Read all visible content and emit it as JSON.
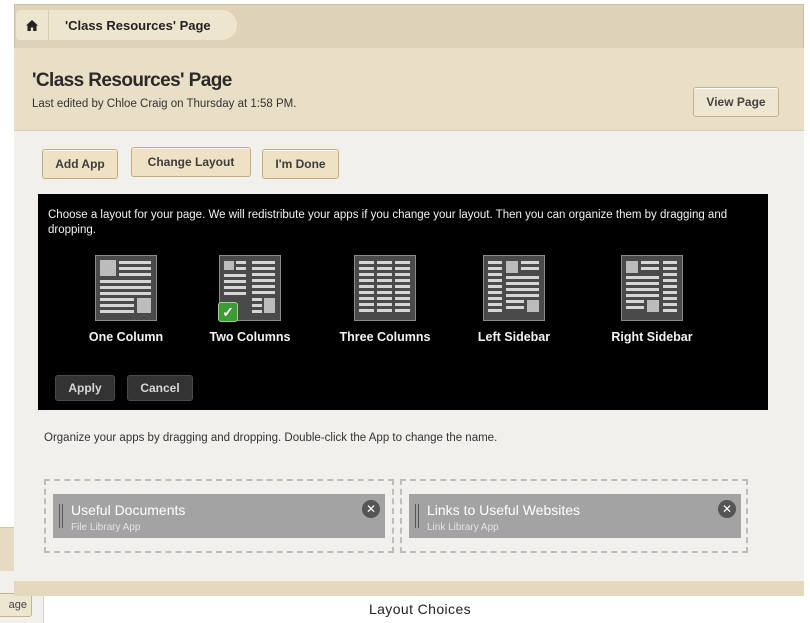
{
  "breadcrumb": {
    "home_icon": "home-icon",
    "current": "'Class Resources' Page"
  },
  "header": {
    "title": "'Class Resources' Page",
    "subtitle": "Last edited by Chloe Craig on Thursday at 1:58 PM.",
    "view_page_label": "View Page"
  },
  "toolbar": {
    "add_app_label": "Add App",
    "change_layout_label": "Change Layout",
    "done_label": "I'm Done"
  },
  "layout_panel": {
    "instructions": "Choose a layout for your page. We will redistribute your apps if you change your layout. Then you can organize them by dragging and dropping.",
    "options": [
      {
        "label": "One Column",
        "icon": "one-column-layout-icon",
        "selected": false
      },
      {
        "label": "Two Columns",
        "icon": "two-columns-layout-icon",
        "selected": true
      },
      {
        "label": "Three Columns",
        "icon": "three-columns-layout-icon",
        "selected": false
      },
      {
        "label": "Left Sidebar",
        "icon": "left-sidebar-layout-icon",
        "selected": false
      },
      {
        "label": "Right Sidebar",
        "icon": "right-sidebar-layout-icon",
        "selected": false
      }
    ],
    "apply_label": "Apply",
    "cancel_label": "Cancel"
  },
  "organize_hint": "Organize your apps by dragging and dropping. Double-click the App to change the name.",
  "columns": [
    {
      "apps": [
        {
          "name": "Useful Documents",
          "type": "File Library App",
          "close_icon": "close-icon"
        }
      ]
    },
    {
      "apps": [
        {
          "name": "Links to Useful Websites",
          "type": "Link Library App",
          "close_icon": "close-icon"
        }
      ]
    }
  ],
  "background_window": {
    "button_label": "age"
  },
  "caption": "Layout Choices",
  "colors": {
    "tan": "#ded3b8",
    "panel": "#000000",
    "app_tile": "#a3a3a3",
    "check_green": "#3d9b35"
  }
}
